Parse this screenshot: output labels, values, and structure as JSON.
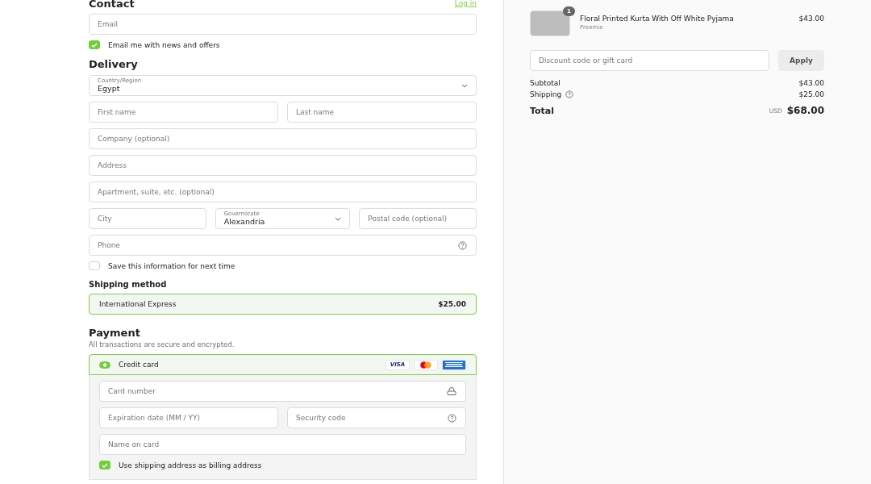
{
  "contact": {
    "heading": "Contact",
    "login_link": "Log in",
    "email": {
      "placeholder": "Email"
    },
    "newsletter": {
      "label": "Email me with news and offers",
      "checked": true
    }
  },
  "delivery": {
    "heading": "Delivery",
    "rows": [
      [
        {
          "kind": "select",
          "label": "Country/Region",
          "value": "Egypt"
        }
      ],
      [
        {
          "kind": "input",
          "placeholder": "First name"
        },
        {
          "kind": "input",
          "placeholder": "Last name"
        }
      ],
      [
        {
          "kind": "input",
          "placeholder": "Company (optional)"
        }
      ],
      [
        {
          "kind": "input",
          "placeholder": "Address"
        }
      ],
      [
        {
          "kind": "input",
          "placeholder": "Apartment, suite, etc. (optional)"
        }
      ],
      [
        {
          "kind": "input",
          "placeholder": "City"
        },
        {
          "kind": "select",
          "label": "Governorate",
          "value": "Alexandria"
        },
        {
          "kind": "input",
          "placeholder": "Postal code (optional)"
        }
      ],
      [
        {
          "kind": "help",
          "placeholder": "Phone"
        }
      ]
    ],
    "save_info": {
      "label": "Save this information for next time",
      "checked": false
    }
  },
  "shipping_method": {
    "heading": "Shipping method",
    "options": [
      {
        "name": "International Express",
        "price": "$25.00",
        "selected": true
      }
    ]
  },
  "payment": {
    "heading": "Payment",
    "note": "All transactions are secure and encrypted.",
    "method": {
      "name": "Credit card",
      "selected": true,
      "brands": [
        {
          "kind": "visa",
          "label": "VISA"
        },
        {
          "kind": "mastercard"
        },
        {
          "kind": "amex"
        }
      ]
    },
    "rows": [
      [
        {
          "kind": "lock",
          "placeholder": "Card number"
        }
      ],
      [
        {
          "kind": "input",
          "placeholder": "Expiration date (MM / YY)"
        },
        {
          "kind": "help",
          "placeholder": "Security code"
        }
      ],
      [
        {
          "kind": "input",
          "placeholder": "Name on card"
        }
      ]
    ],
    "billing_same": {
      "label": "Use shipping address as billing address",
      "checked": true
    }
  },
  "summary": {
    "items": [
      {
        "name": "Floral Printed Kurta With Off White Pyjama",
        "variant": "Preemie",
        "quantity": "1",
        "price": "$43.00"
      }
    ],
    "discount": {
      "placeholder": "Discount code or gift card",
      "button": "Apply"
    },
    "lines": [
      {
        "label": "Subtotal",
        "value": "$43.00",
        "help": false
      },
      {
        "label": "Shipping",
        "value": "$25.00",
        "help": true
      }
    ],
    "total": {
      "label": "Total",
      "currency": "USD",
      "value": "$68.00"
    }
  }
}
